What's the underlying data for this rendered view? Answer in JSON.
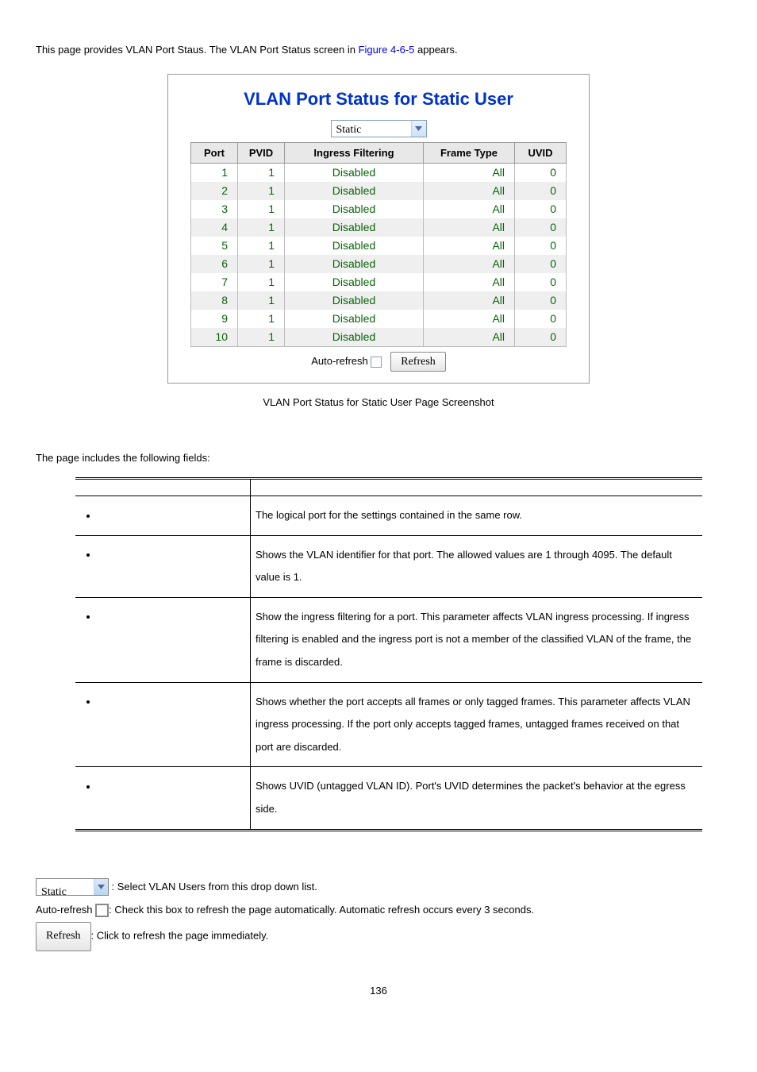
{
  "intro": {
    "prefix": "This page provides VLAN Port Staus. The VLAN Port Status screen in ",
    "figure_link": "Figure 4-6-5",
    "suffix": " appears."
  },
  "screenshot": {
    "title": "VLAN Port Status for Static User",
    "dropdown_value": "Static",
    "headers": {
      "port": "Port",
      "pvid": "PVID",
      "ingress": "Ingress Filtering",
      "frame": "Frame Type",
      "uvid": "UVID"
    },
    "rows": [
      {
        "port": "1",
        "pvid": "1",
        "ingress": "Disabled",
        "frame": "All",
        "uvid": "0"
      },
      {
        "port": "2",
        "pvid": "1",
        "ingress": "Disabled",
        "frame": "All",
        "uvid": "0"
      },
      {
        "port": "3",
        "pvid": "1",
        "ingress": "Disabled",
        "frame": "All",
        "uvid": "0"
      },
      {
        "port": "4",
        "pvid": "1",
        "ingress": "Disabled",
        "frame": "All",
        "uvid": "0"
      },
      {
        "port": "5",
        "pvid": "1",
        "ingress": "Disabled",
        "frame": "All",
        "uvid": "0"
      },
      {
        "port": "6",
        "pvid": "1",
        "ingress": "Disabled",
        "frame": "All",
        "uvid": "0"
      },
      {
        "port": "7",
        "pvid": "1",
        "ingress": "Disabled",
        "frame": "All",
        "uvid": "0"
      },
      {
        "port": "8",
        "pvid": "1",
        "ingress": "Disabled",
        "frame": "All",
        "uvid": "0"
      },
      {
        "port": "9",
        "pvid": "1",
        "ingress": "Disabled",
        "frame": "All",
        "uvid": "0"
      },
      {
        "port": "10",
        "pvid": "1",
        "ingress": "Disabled",
        "frame": "All",
        "uvid": "0"
      }
    ],
    "auto_refresh_label": "Auto-refresh",
    "refresh_button": "Refresh"
  },
  "caption": "VLAN Port Status for Static User Page Screenshot",
  "fields_intro": "The page includes the following fields:",
  "fields_headers": {
    "object": "",
    "description": ""
  },
  "fields": [
    {
      "desc": "The logical port for the settings contained in the same row."
    },
    {
      "desc": "Shows the VLAN identifier for that port. The allowed values are 1 through 4095. The default value is 1."
    },
    {
      "desc": "Show the ingress filtering for a port. This parameter affects VLAN ingress processing. If ingress filtering is enabled and the ingress port is not a member of the classified VLAN of the frame, the frame is discarded."
    },
    {
      "desc": "Shows whether the port accepts all frames or only tagged frames. This parameter affects VLAN ingress processing. If the port only accepts tagged frames, untagged frames received on that port are discarded."
    },
    {
      "desc": "Shows UVID (untagged VLAN ID). Port's UVID determines the packet's behavior at the egress side."
    }
  ],
  "footer": {
    "static_select": "Static",
    "static_desc": ": Select VLAN Users from this drop down list.",
    "autorefresh_prefix": "Auto-refresh ",
    "autorefresh_desc": ": Check this box to refresh the page automatically. Automatic refresh occurs every 3 seconds.",
    "refresh_btn": "Refresh",
    "refresh_desc": ": Click to refresh the page immediately."
  },
  "page_number": "136"
}
